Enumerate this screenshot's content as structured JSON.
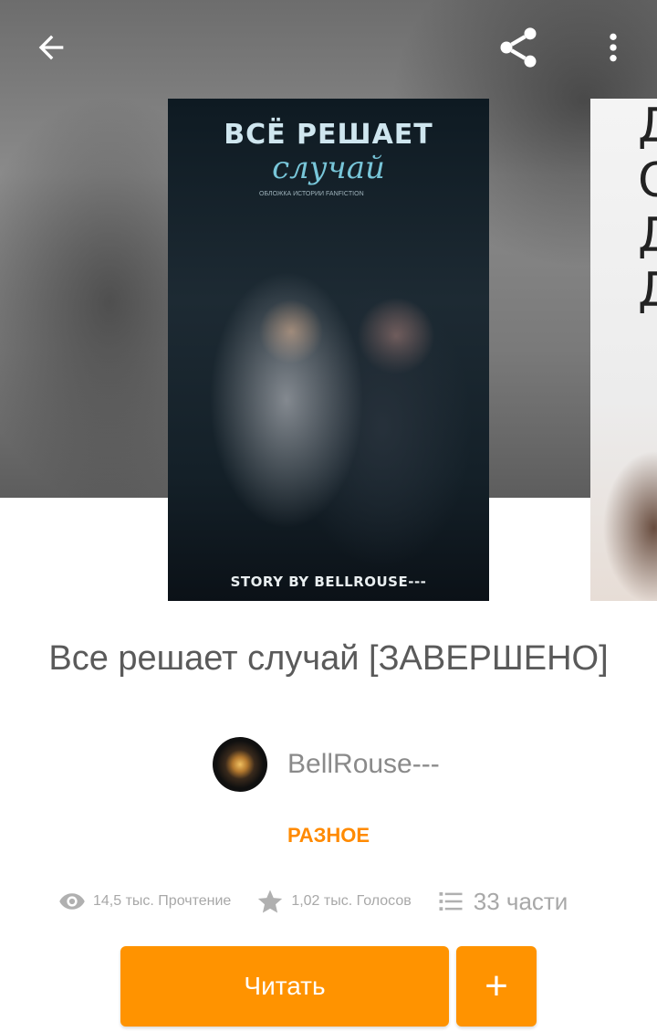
{
  "header": {
    "back_icon": "arrow-left-icon",
    "share_icon": "share-icon",
    "more_icon": "more-vertical-icon"
  },
  "cover": {
    "title_line1": "ВСЁ РЕШАЕТ",
    "title_line2": "случай",
    "small_text": "ОБЛОЖКА ИСТОРИИ FANFICTION",
    "byline": "STORY BY BELLROUSE---",
    "next_cover_letters": "Д О Д Д"
  },
  "story": {
    "title": "Все решает случай [ЗАВЕРШЕНО]",
    "author": "BellRouse---",
    "category": "РАЗНОЕ"
  },
  "stats": {
    "reads": "14,5 тыс. Прочтение",
    "votes": "1,02 тыс. Голосов",
    "parts": "33 части"
  },
  "actions": {
    "read_label": "Читать",
    "add_label": "+"
  },
  "colors": {
    "accent": "#ff9300",
    "category": "#ff8a00"
  }
}
